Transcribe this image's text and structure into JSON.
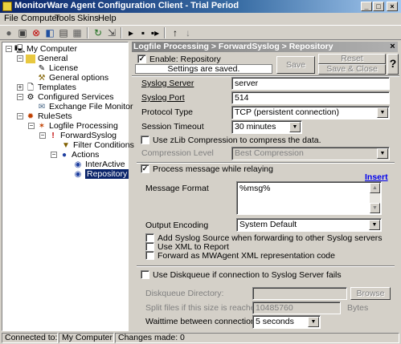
{
  "window": {
    "title": "MonitorWare Agent Configuration Client - Trial Period"
  },
  "menu": [
    "File",
    "Computer",
    "Tools",
    "Skins",
    "Help"
  ],
  "tree": {
    "root": "My Computer",
    "general": "General",
    "license": "License",
    "general_options": "General options",
    "templates": "Templates",
    "configured_services": "Configured Services",
    "exchange_file_monitor": "Exchange File Monitor",
    "rulesets": "RuleSets",
    "logfile_processing": "Logfile Processing",
    "forward_syslog": "ForwardSyslog",
    "filter_conditions": "Filter Conditions",
    "actions": "Actions",
    "interactive": "InterActive",
    "repository": "Repository"
  },
  "panel": {
    "breadcrumb": "Logfile Processing > ForwardSyslog > Repository",
    "enable_label": "Enable: Repository",
    "saved_message": "Settings are saved.",
    "save_label": "Save",
    "reset_label": "Reset",
    "save_close_label": "Save & Close",
    "help_label": "?",
    "syslog_server_label": "Syslog Server",
    "syslog_server_value": "server",
    "syslog_port_label": "Syslog Port",
    "syslog_port_value": "514",
    "protocol_type_label": "Protocol Type",
    "protocol_type_value": "TCP (persistent connection)",
    "session_timeout_label": "Session Timeout",
    "session_timeout_value": "30 minutes",
    "zlib_label": "Use zLib Compression to compress the data.",
    "compression_level_label": "Compression Level",
    "compression_level_value": "Best Compression",
    "process_relaying_label": "Process message while relaying",
    "insert_label": "Insert",
    "message_format_label": "Message Format",
    "message_format_value": "%msg%",
    "output_encoding_label": "Output Encoding",
    "output_encoding_value": "System Default",
    "add_syslog_source_label": "Add Syslog Source when forwarding to other Syslog servers",
    "use_xml_label": "Use XML to Report",
    "forward_mwagent_label": "Forward as MWAgent XML representation code",
    "use_diskqueue_label": "Use Diskqueue if connection to Syslog Server fails",
    "diskqueue_dir_label": "Diskqueue Directory:",
    "diskqueue_dir_value": "",
    "browse_label": "Browse",
    "split_files_label": "Split files if this size is reached:",
    "split_files_value": "10485760",
    "bytes_label": "Bytes",
    "waittime_label": "Waittime between connection tries:",
    "waittime_value": "5 seconds"
  },
  "checkboxes": {
    "enable": true,
    "zlib": false,
    "process_relaying": true,
    "add_syslog_source": false,
    "use_xml": false,
    "forward_mwagent": false,
    "use_diskqueue": false
  },
  "status": {
    "connected_to_label": "Connected to:",
    "computer": "My Computer",
    "changes": "Changes made: 0"
  }
}
